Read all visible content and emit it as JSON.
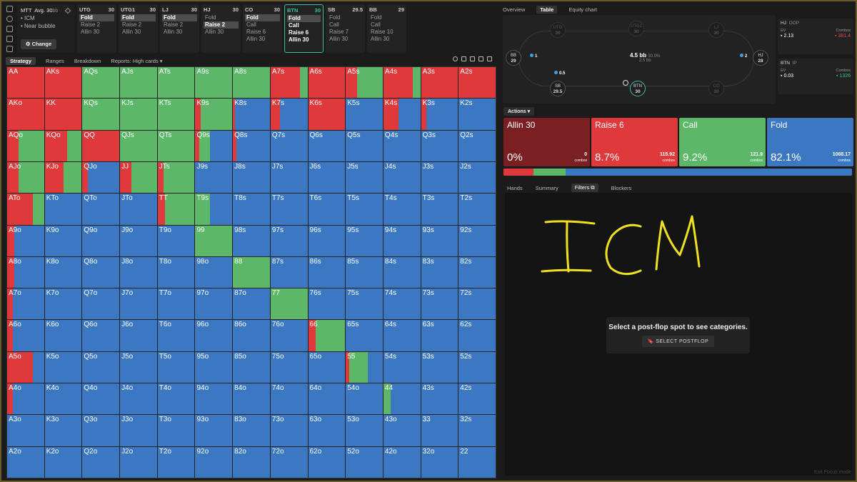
{
  "header": {
    "mode": "MTT",
    "avg_label": "Avg. 30",
    "avg_unit": "bb",
    "options": [
      "ICM",
      "Near bubble"
    ],
    "change_label": "Change"
  },
  "positions": [
    {
      "name": "UTG",
      "stack": "30",
      "actions": [
        "Fold",
        "Raise 2",
        "Allin 30"
      ],
      "selected": 0,
      "active": false
    },
    {
      "name": "UTG1",
      "stack": "30",
      "actions": [
        "Fold",
        "Raise 2",
        "Allin 30"
      ],
      "selected": 0,
      "active": false
    },
    {
      "name": "LJ",
      "stack": "30",
      "actions": [
        "Fold",
        "Raise 2",
        "Allin 30"
      ],
      "selected": 0,
      "active": false
    },
    {
      "name": "HJ",
      "stack": "30",
      "actions": [
        "Fold",
        "Raise 2",
        "Allin 30"
      ],
      "selected": 1,
      "active": false
    },
    {
      "name": "CO",
      "stack": "30",
      "actions": [
        "Fold",
        "Call",
        "Raise 6",
        "Allin 30"
      ],
      "selected": 0,
      "active": false
    },
    {
      "name": "BTN",
      "stack": "30",
      "actions": [
        "Fold",
        "Call",
        "Raise 6",
        "Allin 30"
      ],
      "selected": 0,
      "active": true
    },
    {
      "name": "SB",
      "stack": "29.5",
      "actions": [
        "Fold",
        "Call",
        "Raise 7",
        "Allin 30"
      ],
      "selected": -1,
      "active": false
    },
    {
      "name": "BB",
      "stack": "29",
      "actions": [
        "Fold",
        "Call",
        "Raise 10",
        "Allin 30"
      ],
      "selected": -1,
      "active": false
    }
  ],
  "subtabs": [
    "Strategy",
    "Ranges",
    "Breakdown",
    "Reports: High cards"
  ],
  "right_tabs": [
    "Overview",
    "Table",
    "Equity chart"
  ],
  "table": {
    "pot": "4.5 bb",
    "pot_pct": "30.0%",
    "pot_sub": "2.5 bb",
    "seats": [
      {
        "name": "UTG",
        "stack": "30",
        "dim": true
      },
      {
        "name": "UTG1",
        "stack": "30",
        "dim": true
      },
      {
        "name": "LJ",
        "stack": "30",
        "dim": true
      },
      {
        "name": "HJ",
        "stack": "28",
        "dim": false
      },
      {
        "name": "CO",
        "stack": "30",
        "dim": true
      },
      {
        "name": "BTN",
        "stack": "30",
        "dim": false
      },
      {
        "name": "SB",
        "stack": "29.5",
        "dim": false
      },
      {
        "name": "BB",
        "stack": "29",
        "dim": false
      }
    ],
    "chips": {
      "bb": "1",
      "sb": "0.5",
      "hj": "2"
    }
  },
  "ev_boxes": [
    {
      "name": "HJ",
      "tag": "OOP",
      "ev_label": "EV",
      "ev": "2.13",
      "combos_label": "Combos",
      "combos": "381.4",
      "combos_color": "#e04a4a"
    },
    {
      "name": "BTN",
      "tag": "IP",
      "ev_label": "EV",
      "ev": "0.03",
      "combos_label": "Combos",
      "combos": "1326",
      "combos_color": "#3bbfa7"
    }
  ],
  "actions_label": "Actions",
  "actions": [
    {
      "name": "Allin 30",
      "pct": "0%",
      "combos": "0",
      "combos_label": "combos",
      "color": "#7a1f22"
    },
    {
      "name": "Raise 6",
      "pct": "8.7%",
      "combos": "115.92",
      "combos_label": "combos",
      "color": "#e0393c"
    },
    {
      "name": "Call",
      "pct": "9.2%",
      "combos": "121.9",
      "combos_label": "combos",
      "color": "#5cb868"
    },
    {
      "name": "Fold",
      "pct": "82.1%",
      "combos": "1088.17",
      "combos_label": "combos",
      "color": "#3c78c2"
    }
  ],
  "bottom_tabs": [
    "Hands",
    "Summary",
    "Filters",
    "Blockers"
  ],
  "filter_panel": {
    "message": "Select a post-flop spot to see categories.",
    "button": "SELECT POSTFLOP"
  },
  "handwriting": "ICM",
  "exit_focus": "Exit Focus mode",
  "colors": {
    "raise": "#e0393c",
    "call": "#5cb868",
    "fold": "#3c78c2",
    "allin": "#7a1f22",
    "accent": "#3bbfa7"
  },
  "hand_grid": {
    "ranks": [
      "A",
      "K",
      "Q",
      "J",
      "T",
      "9",
      "8",
      "7",
      "6",
      "5",
      "4",
      "3",
      "2"
    ],
    "strategy": {
      "AA": [
        1,
        0
      ],
      "AKs": [
        1,
        0
      ],
      "AQs": [
        0,
        1
      ],
      "AJs": [
        0,
        1
      ],
      "ATs": [
        0,
        1
      ],
      "A9s": [
        0,
        1
      ],
      "A8s": [
        0,
        1
      ],
      "A7s": [
        0.8,
        0.2
      ],
      "A6s": [
        1,
        0
      ],
      "A5s": [
        0.3,
        0.7
      ],
      "A4s": [
        0.8,
        0.2
      ],
      "A3s": [
        1,
        0
      ],
      "A2s": [
        1,
        0
      ],
      "AKo": [
        1,
        0
      ],
      "KK": [
        1,
        0
      ],
      "KQs": [
        0,
        1
      ],
      "KJs": [
        0,
        1
      ],
      "KTs": [
        0,
        1
      ],
      "K9s": [
        0.15,
        0.85
      ],
      "K8s": [
        0.05,
        0
      ],
      "K7s": [
        0.25,
        0
      ],
      "K6s": [
        1,
        0
      ],
      "K5s": [
        0,
        0
      ],
      "K4s": [
        0.4,
        0
      ],
      "K3s": [
        0.15,
        0
      ],
      "AQo": [
        0.3,
        0.7
      ],
      "KQo": [
        0.6,
        0.4
      ],
      "QQ": [
        1,
        0
      ],
      "QJs": [
        0,
        1
      ],
      "QTs": [
        0,
        1
      ],
      "Q9s": [
        0.1,
        0.3
      ],
      "Q8s": [
        0.1,
        0
      ],
      "AJo": [
        0.3,
        0.7
      ],
      "KJo": [
        0.5,
        0.5
      ],
      "QJo": [
        0.15,
        0
      ],
      "JJ": [
        0.3,
        0.7
      ],
      "JTs": [
        0.15,
        0.85
      ],
      "ATo": [
        0.7,
        0.3
      ],
      "TT": [
        0.2,
        0.8
      ],
      "T9s": [
        0,
        0.4
      ],
      "A9o": [
        0.2,
        0
      ],
      "99": [
        0,
        1
      ],
      "A8o": [
        0.2,
        0
      ],
      "88": [
        0,
        1
      ],
      "A7o": [
        0.15,
        0
      ],
      "77": [
        0,
        1
      ],
      "A6o": [
        0.15,
        0
      ],
      "66": [
        0.2,
        0.8
      ],
      "A5o": [
        0.7,
        0
      ],
      "55": [
        0.1,
        0.5
      ],
      "A4o": [
        0.15,
        0
      ],
      "44": [
        0,
        0.2
      ]
    }
  }
}
